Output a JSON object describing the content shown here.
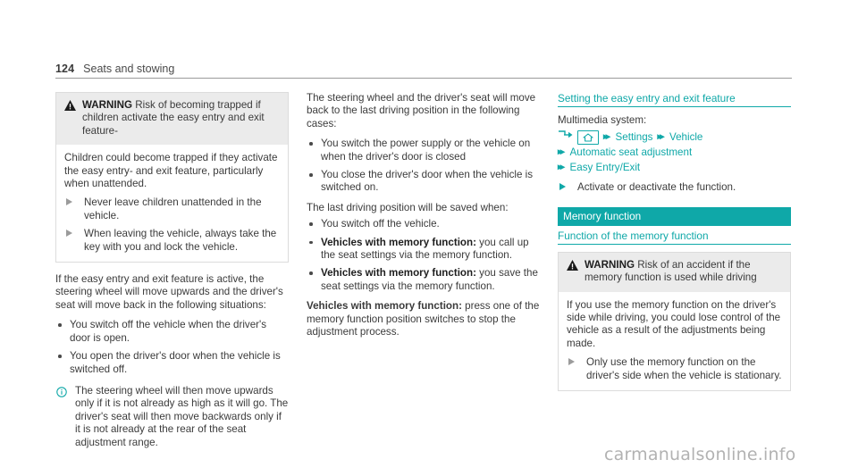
{
  "header": {
    "page_number": "124",
    "chapter": "Seats and stowing"
  },
  "left_column": {
    "warning": {
      "icon": "warning-triangle-icon",
      "label": "WARNING",
      "title": " Risk of becoming trapped if children activate the easy entry and exit feature-",
      "body_paragraph": "Children could become trapped if they activate the easy entry- and exit feature, particularly when unattended.",
      "actions": [
        "Never leave children unattended in the vehicle.",
        "When leaving the vehicle, always take the key with you and lock the vehicle."
      ]
    },
    "intro": "If the easy entry and exit feature is active, the steering wheel will move upwards and the driver's seat will move back in the following situations:",
    "bullets": [
      "You switch off the vehicle when the driver's door is open.",
      "You open the driver's door when the vehicle is switched off."
    ],
    "note": {
      "icon": "info-icon",
      "text": "The steering wheel will then move upwards only if it is not already as high as it will go. The driver's seat will then move backwards only if it is not already at the rear of the seat adjustment range."
    }
  },
  "middle_column": {
    "intro": "The steering wheel and the driver's seat will move back to the last driving position in the following cases:",
    "bullets": [
      "You switch the power supply or the vehicle on when the driver's door is closed",
      "You close the driver's door when the vehicle is switched on."
    ],
    "saved_intro": "The last driving position will be saved when:",
    "saved_bullets": [
      {
        "bold": "",
        "text": "You switch off the vehicle."
      },
      {
        "bold": "Vehicles with memory function:",
        "text": " you call up the seat settings via the memory function."
      },
      {
        "bold": "Vehicles with memory function:",
        "text": " you save the seat settings via the memory function."
      }
    ],
    "closing": {
      "bold": "Vehicles with memory function:",
      "text": " press one of the memory function position switches to stop the adjustment process."
    }
  },
  "right_column": {
    "setting_heading": "Setting the easy entry and exit feature",
    "multimedia_label": "Multimedia system:",
    "nav_path": {
      "arrow_icon": "arrow-right-icon",
      "home_icon": "home-icon",
      "chevron": "▸▸",
      "items_line1": [
        "Settings",
        "Vehicle"
      ],
      "items_line2": [
        "Automatic seat adjustment"
      ],
      "items_line3": [
        "Easy Entry/Exit"
      ]
    },
    "action": "Activate or deactivate the function.",
    "band_title": "Memory function",
    "function_heading": "Function of the memory function",
    "warning": {
      "icon": "warning-triangle-icon",
      "label": "WARNING",
      "title": " Risk of an accident if the memory function is used while driving",
      "body_paragraph": "If you use the memory function on the driver's side while driving, you could lose control of the vehicle as a result of the adjustments being made.",
      "actions": [
        "Only use the memory function on the driver's side when the vehicle is stationary."
      ]
    }
  },
  "watermark": "carmanualsonline.info",
  "colors": {
    "teal": "#0fa8a8",
    "warning_header_bg": "#ebebeb",
    "text": "#3b3b3b",
    "watermark": "#b2b2b2"
  }
}
